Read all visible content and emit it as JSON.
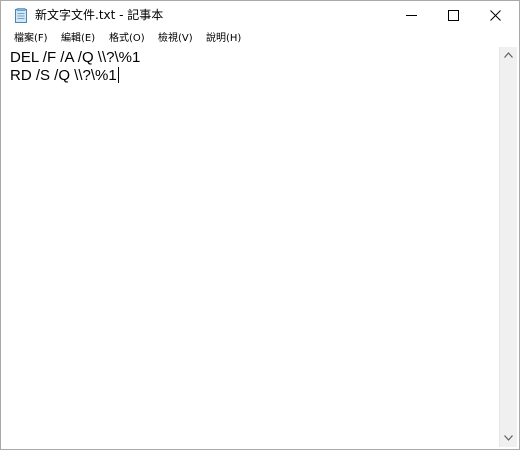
{
  "window": {
    "title": "新文字文件.txt - 記事本",
    "icon": "notepad-icon"
  },
  "menubar": {
    "items": [
      {
        "label": "檔案(F)"
      },
      {
        "label": "編輯(E)"
      },
      {
        "label": "格式(O)"
      },
      {
        "label": "檢視(V)"
      },
      {
        "label": "說明(H)"
      }
    ]
  },
  "editor": {
    "lines": [
      "DEL /F /A /Q \\\\?\\%1",
      "RD /S /Q \\\\?\\%1"
    ]
  },
  "controls": {
    "minimize_icon": "minimize-icon",
    "maximize_icon": "maximize-icon",
    "close_icon": "close-icon"
  }
}
